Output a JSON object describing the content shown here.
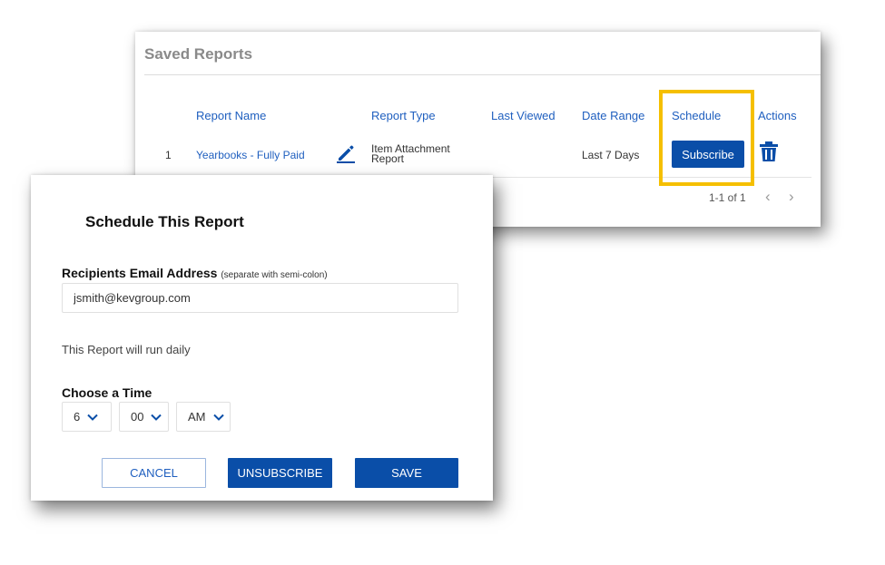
{
  "reports": {
    "title": "Saved Reports",
    "columns": [
      "Report Name",
      "Report Type",
      "Last Viewed",
      "Date Range",
      "Schedule",
      "Actions"
    ],
    "rows": [
      {
        "index": "1",
        "name": "Yearbooks - Fully Paid",
        "type": "Item Attachment Report",
        "last_viewed": "",
        "date_range": "Last 7 Days",
        "schedule_button": "Subscribe"
      }
    ],
    "pagination": "1-1 of 1",
    "prev_symbol": "‹",
    "next_symbol": "›",
    "highlight_color": "#f5bf00",
    "accent_color": "#0a4ea8"
  },
  "dialog": {
    "title": "Schedule This Report",
    "recipients_label": "Recipients Email Address",
    "recipients_hint": "(separate with semi-colon)",
    "email_value": "jsmith@kevgroup.com",
    "run_text": "This Report will run daily",
    "time_label": "Choose a Time",
    "hour": "6",
    "minute": "00",
    "meridiem": "AM",
    "cancel_label": "CANCEL",
    "unsubscribe_label": "UNSUBSCRIBE",
    "save_label": "SAVE"
  },
  "icons": {
    "edit": "pencil-icon",
    "delete": "trash-icon",
    "dropdown": "chevron-down-icon"
  }
}
